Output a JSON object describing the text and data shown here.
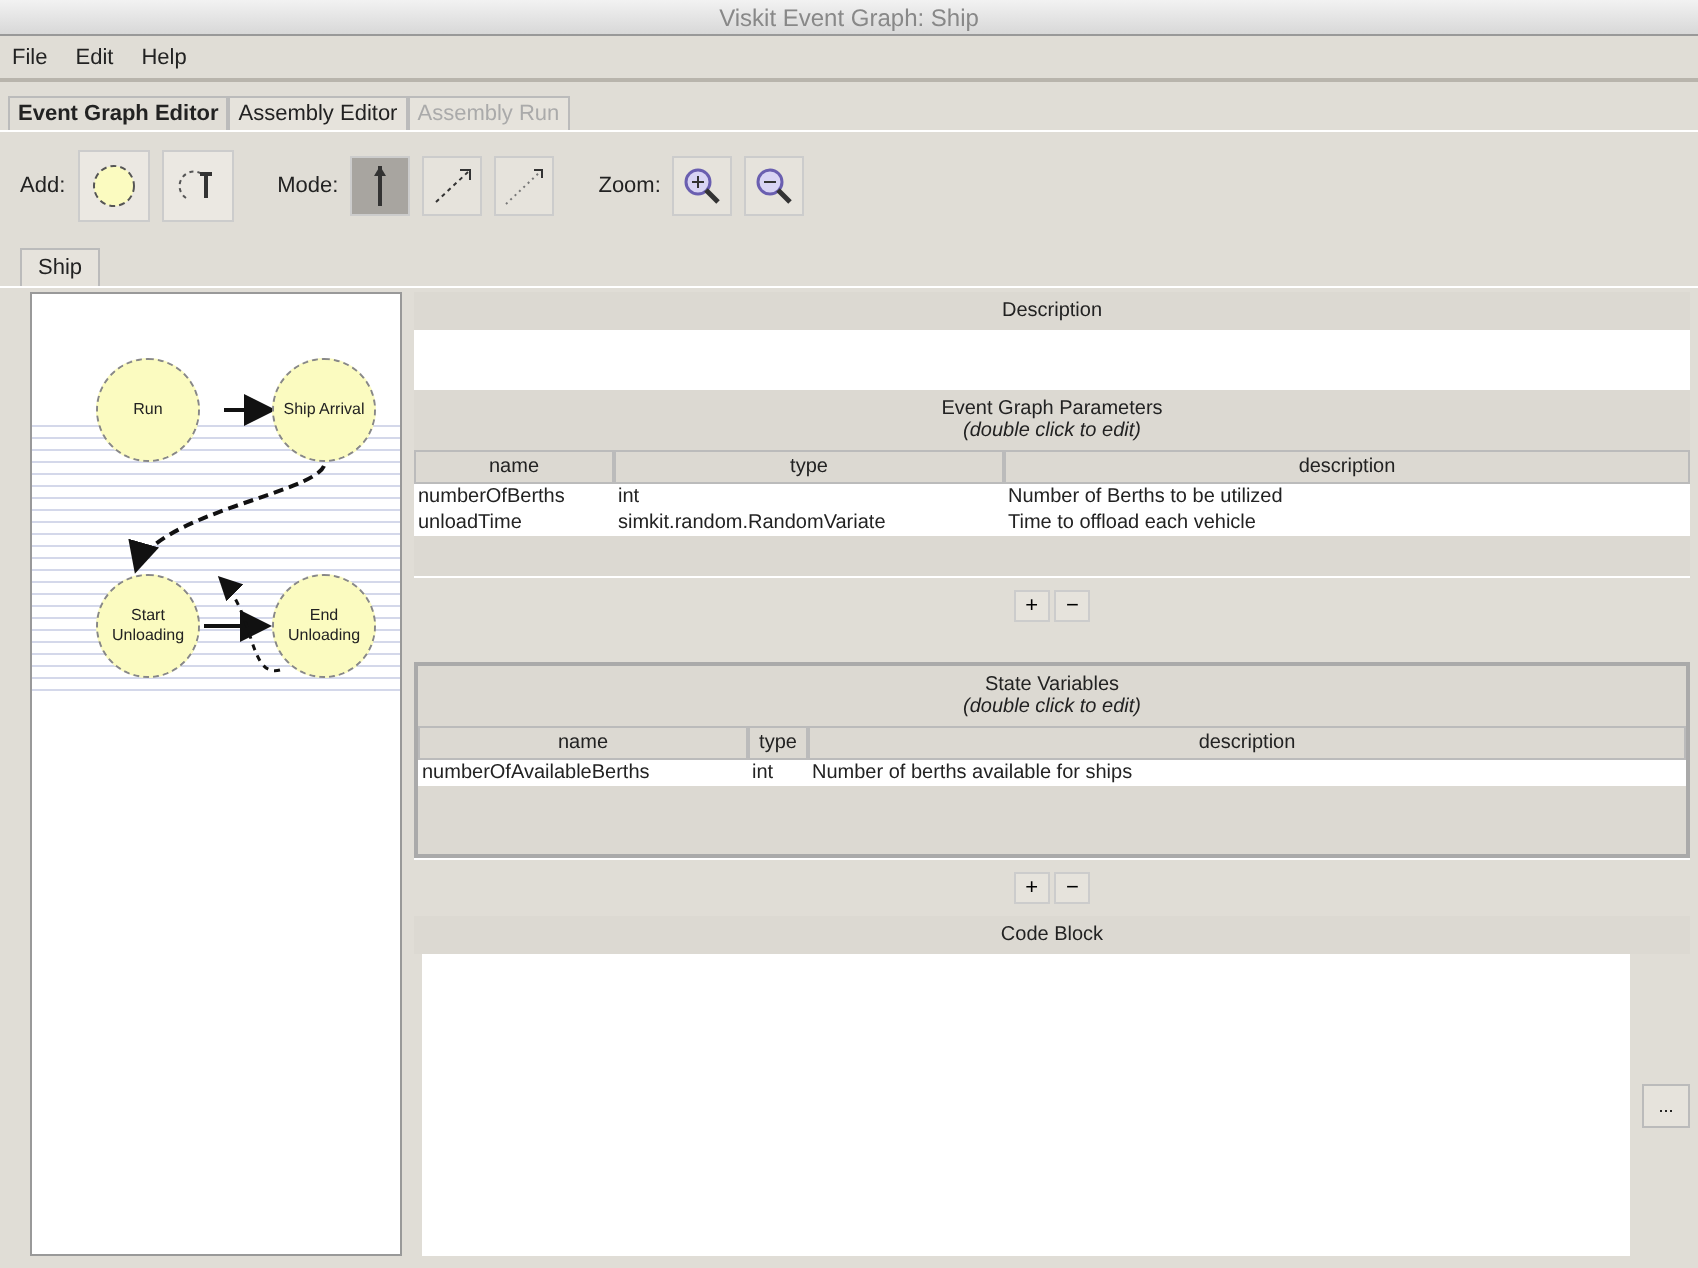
{
  "window": {
    "title": "Viskit Event Graph: Ship"
  },
  "menu": [
    "File",
    "Edit",
    "Help"
  ],
  "tabs": [
    {
      "label": "Event Graph Editor",
      "selected": true
    },
    {
      "label": "Assembly Editor",
      "selected": false
    },
    {
      "label": "Assembly Run",
      "selected": false,
      "disabled": true
    }
  ],
  "toolbar": {
    "add_label": "Add:",
    "mode_label": "Mode:",
    "zoom_label": "Zoom:",
    "modes": [
      {
        "kind": "select",
        "selected": true
      },
      {
        "kind": "edge",
        "selected": false
      },
      {
        "kind": "cancel",
        "selected": false
      }
    ]
  },
  "graph_tab": {
    "label": "Ship"
  },
  "graph": {
    "nodes": [
      {
        "label": "Run"
      },
      {
        "label": "Ship Arrival"
      },
      {
        "label": "Start Unloading"
      },
      {
        "label": "End Unloading"
      }
    ]
  },
  "description": {
    "title": "Description"
  },
  "parameters": {
    "title": "Event Graph Parameters",
    "hint": "(double click to edit)",
    "columns": [
      "name",
      "type",
      "description"
    ],
    "rows": [
      [
        "numberOfBerths",
        "int",
        "Number of Berths to be utilized"
      ],
      [
        "unloadTime",
        "simkit.random.RandomVariate",
        "Time to offload each vehicle"
      ]
    ]
  },
  "state_variables": {
    "title": "State Variables",
    "hint": "(double click to edit)",
    "columns": [
      "name",
      "type",
      "description"
    ],
    "rows": [
      [
        "numberOfAvailableBerths",
        "int",
        "Number of berths available for ships"
      ]
    ]
  },
  "add_button": "+",
  "remove_button": "−",
  "code_block": {
    "title": "Code Block",
    "button": "..."
  }
}
